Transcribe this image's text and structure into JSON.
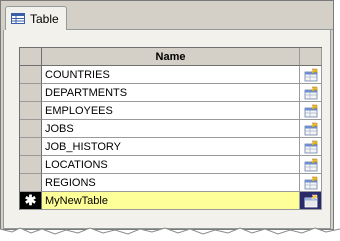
{
  "tab": {
    "label": "Table",
    "icon": "table-icon"
  },
  "grid": {
    "column_header": "Name",
    "rows": [
      {
        "name": "COUNTRIES"
      },
      {
        "name": "DEPARTMENTS"
      },
      {
        "name": "EMPLOYEES"
      },
      {
        "name": "JOBS"
      },
      {
        "name": "JOB_HISTORY"
      },
      {
        "name": "LOCATIONS"
      },
      {
        "name": "REGIONS"
      }
    ],
    "new_row": {
      "name": "MyNewTable",
      "marker": "✱"
    }
  },
  "colors": {
    "new_row_highlight": "#ffff99",
    "selector_bg": "#d4d0c8"
  }
}
